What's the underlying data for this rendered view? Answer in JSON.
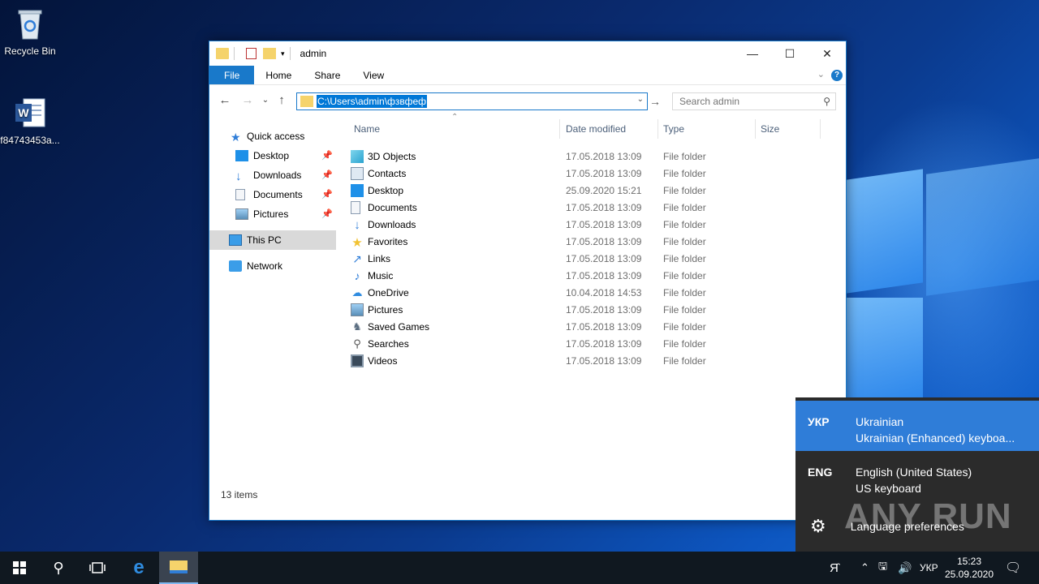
{
  "desktop": {
    "icons": [
      {
        "label": "Recycle Bin"
      },
      {
        "label": "f84743453a..."
      }
    ]
  },
  "explorer": {
    "title": "admin",
    "ribbon_tabs": [
      "File",
      "Home",
      "Share",
      "View"
    ],
    "address": "C:\\Users\\admin\\фзвфеф",
    "search_placeholder": "Search admin",
    "nav": {
      "quick_access": "Quick access",
      "pinned": [
        "Desktop",
        "Downloads",
        "Documents",
        "Pictures"
      ],
      "this_pc": "This PC",
      "network": "Network"
    },
    "columns": [
      "Name",
      "Date modified",
      "Type",
      "Size"
    ],
    "rows": [
      {
        "name": "3D Objects",
        "date": "17.05.2018 13:09",
        "type": "File folder",
        "icon": "3d-objects-icon"
      },
      {
        "name": "Contacts",
        "date": "17.05.2018 13:09",
        "type": "File folder",
        "icon": "contacts-icon"
      },
      {
        "name": "Desktop",
        "date": "25.09.2020 15:21",
        "type": "File folder",
        "icon": "desktop-icon"
      },
      {
        "name": "Documents",
        "date": "17.05.2018 13:09",
        "type": "File folder",
        "icon": "documents-icon"
      },
      {
        "name": "Downloads",
        "date": "17.05.2018 13:09",
        "type": "File folder",
        "icon": "downloads-icon"
      },
      {
        "name": "Favorites",
        "date": "17.05.2018 13:09",
        "type": "File folder",
        "icon": "star-icon"
      },
      {
        "name": "Links",
        "date": "17.05.2018 13:09",
        "type": "File folder",
        "icon": "links-icon"
      },
      {
        "name": "Music",
        "date": "17.05.2018 13:09",
        "type": "File folder",
        "icon": "music-icon"
      },
      {
        "name": "OneDrive",
        "date": "10.04.2018 14:53",
        "type": "File folder",
        "icon": "onedrive-icon"
      },
      {
        "name": "Pictures",
        "date": "17.05.2018 13:09",
        "type": "File folder",
        "icon": "pictures-icon"
      },
      {
        "name": "Saved Games",
        "date": "17.05.2018 13:09",
        "type": "File folder",
        "icon": "saved-games-icon"
      },
      {
        "name": "Searches",
        "date": "17.05.2018 13:09",
        "type": "File folder",
        "icon": "search-icon"
      },
      {
        "name": "Videos",
        "date": "17.05.2018 13:09",
        "type": "File folder",
        "icon": "videos-icon"
      }
    ],
    "status": "13 items"
  },
  "language_flyout": {
    "options": [
      {
        "code": "УКР",
        "language": "Ukrainian",
        "keyboard": "Ukrainian (Enhanced) keyboa..."
      },
      {
        "code": "ENG",
        "language": "English (United States)",
        "keyboard": "US keyboard"
      }
    ],
    "preferences": "Language preferences"
  },
  "watermark": "ANY RUN",
  "taskbar": {
    "lang_indicator": "УКР",
    "time": "15:23",
    "date": "25.09.2020"
  },
  "colors": {
    "accent": "#1979ca",
    "selected_lang": "#2f7dd8",
    "flyout_bg": "#2b2b2b",
    "taskbar_bg": "#101820"
  }
}
